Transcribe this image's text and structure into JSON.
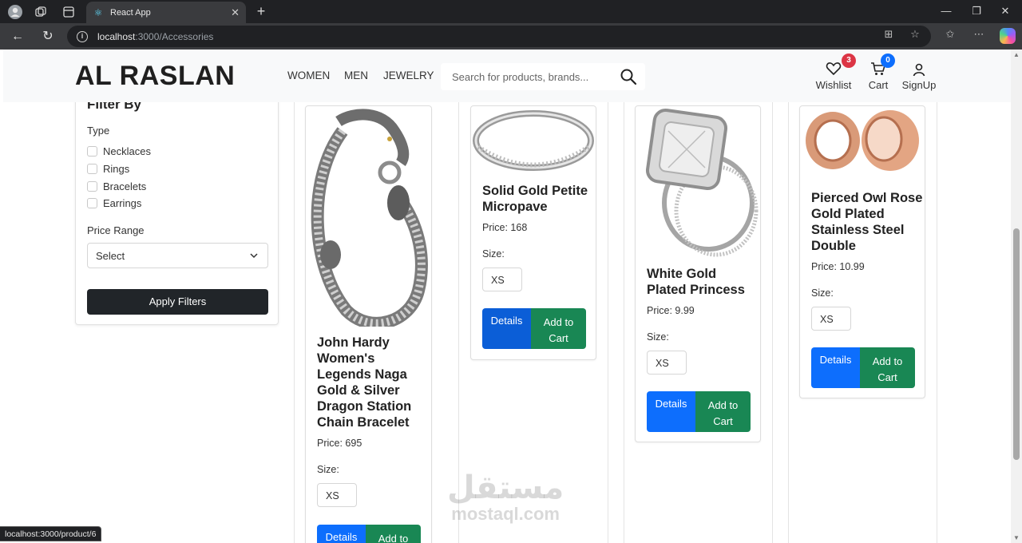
{
  "browser": {
    "tab_title": "React App",
    "url_host": "localhost",
    "url_rest": ":3000/Accessories",
    "status_url": "localhost:3000/product/6"
  },
  "header": {
    "logo": "AL RASLAN",
    "nav": [
      "WOMEN",
      "MEN",
      "JEWELRY"
    ],
    "search_placeholder": "Search for products, brands...",
    "wishlist_label": "Wishlist",
    "wishlist_count": "3",
    "cart_label": "Cart",
    "cart_count": "0",
    "signup_label": "SignUp"
  },
  "filter": {
    "title": "Filter By",
    "type_label": "Type",
    "types": [
      "Necklaces",
      "Rings",
      "Bracelets",
      "Earrings"
    ],
    "price_label": "Price Range",
    "price_selected": "Select",
    "apply_label": "Apply Filters"
  },
  "products": [
    {
      "name": "John Hardy Women's Legends Naga Gold & Silver Dragon Station Chain Bracelet",
      "price": "Price: 695",
      "size_label": "Size:",
      "size": "XS",
      "details": "Details",
      "add_to_cart": "Add to Cart",
      "image": "silver-dragon-bracelet"
    },
    {
      "name": "Solid Gold Petite Micropave",
      "price": "Price: 168",
      "size_label": "Size:",
      "size": "XS",
      "details": "Details",
      "add_to_cart": "Add to Cart",
      "image": "diamond-band-ring"
    },
    {
      "name": "White Gold Plated Princess",
      "price": "Price: 9.99",
      "size_label": "Size:",
      "size": "XS",
      "details": "Details",
      "add_to_cart": "Add to Cart",
      "image": "princess-cut-ring-set"
    },
    {
      "name": "Pierced Owl Rose Gold Plated Stainless Steel Double",
      "price": "Price: 10.99",
      "size_label": "Size:",
      "size": "XS",
      "details": "Details",
      "add_to_cart": "Add to Cart",
      "image": "rose-gold-tunnel-plugs"
    }
  ],
  "watermark": {
    "arabic": "مستقل",
    "latin": "mostaql.com"
  }
}
